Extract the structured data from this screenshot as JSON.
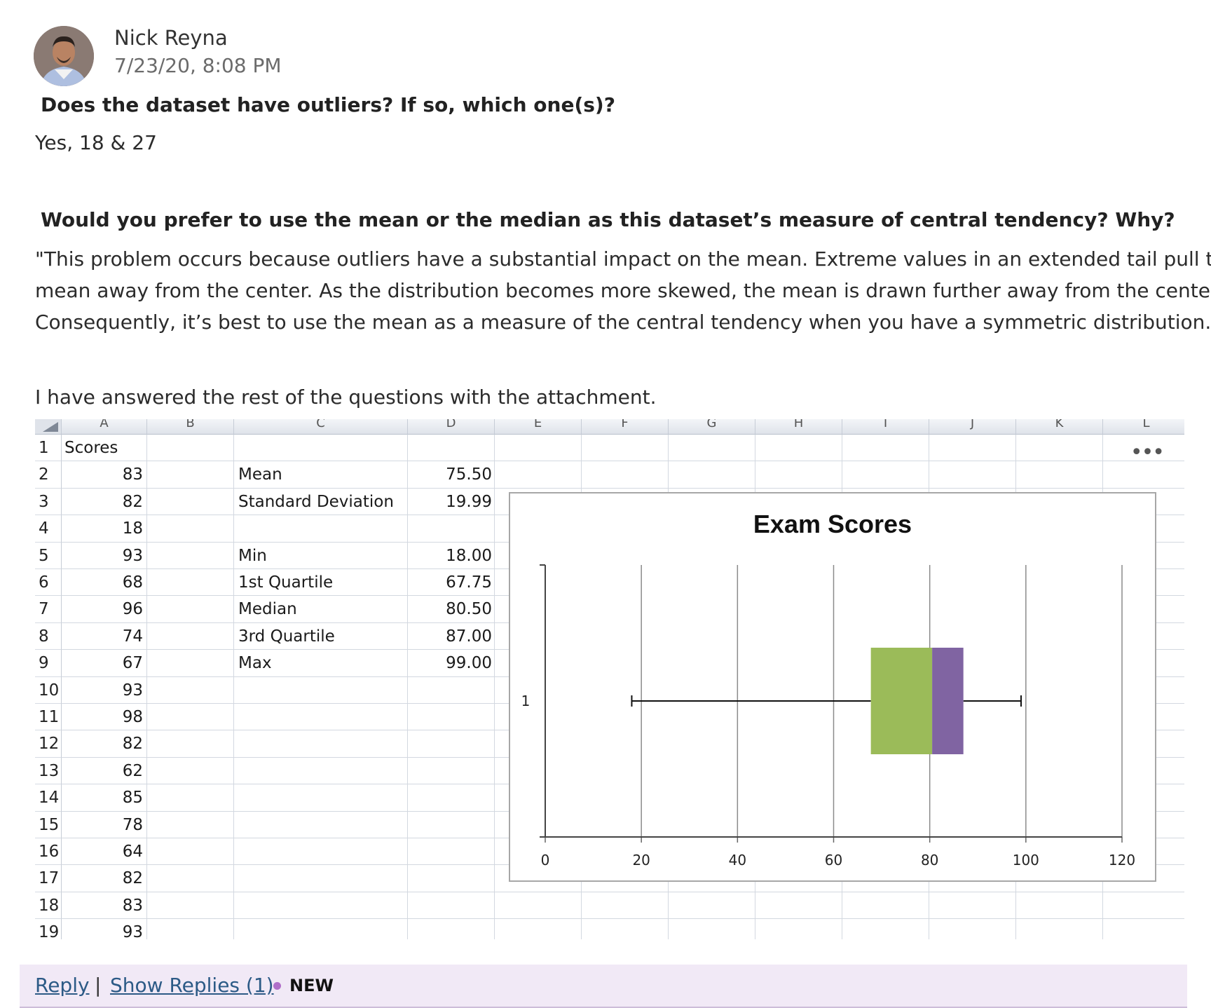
{
  "post": {
    "author": "Nick Reyna",
    "timestamp": "7/23/20, 8:08 PM",
    "q1": "Does the dataset have outliers? If so, which one(s)?",
    "a1": "Yes, 18 & 27",
    "q2": "Would you prefer to use the mean or the median as this dataset’s measure of central tendency? Why?",
    "a2_lines": [
      "\"This problem occurs because outliers have a substantial impact on the mean. Extreme values in an extended tail pull the",
      "mean away from the center. As the distribution becomes more skewed, the mean is drawn further away from the center.",
      "Consequently, it’s best to use the mean as a measure of the central tendency when you have a symmetric distribution.\""
    ],
    "note": "I have answered the rest of the questions with the attachment."
  },
  "spreadsheet": {
    "columns": [
      "A",
      "B",
      "C",
      "D",
      "E",
      "F",
      "G",
      "H",
      "I",
      "J",
      "K",
      "L"
    ],
    "rows": [
      "1",
      "2",
      "3",
      "4",
      "5",
      "6",
      "7",
      "8",
      "9",
      "10",
      "11",
      "12",
      "13",
      "14",
      "15",
      "16",
      "17",
      "18",
      "19"
    ],
    "header": "Scores",
    "scores": [
      "83",
      "82",
      "18",
      "93",
      "68",
      "96",
      "74",
      "67",
      "93",
      "98",
      "82",
      "62",
      "85",
      "78",
      "64",
      "82",
      "83",
      "93"
    ],
    "stats": [
      {
        "label": "Mean",
        "value": "75.50",
        "row": 2
      },
      {
        "label": "Standard Deviation",
        "value": "19.99",
        "row": 3
      },
      {
        "label": "Min",
        "value": "18.00",
        "row": 5
      },
      {
        "label": "1st Quartile",
        "value": "67.75",
        "row": 6
      },
      {
        "label": "Median",
        "value": "80.50",
        "row": 7
      },
      {
        "label": "3rd Quartile",
        "value": "87.00",
        "row": 8
      },
      {
        "label": "Max",
        "value": "99.00",
        "row": 9
      }
    ],
    "more_icon": "more-horizontal-icon"
  },
  "chart_data": {
    "type": "boxplot",
    "title": "Exam Scores",
    "category": "1",
    "xlim": [
      0,
      120
    ],
    "xticks": [
      "0",
      "20",
      "40",
      "60",
      "80",
      "100",
      "120"
    ],
    "grid": true,
    "min": 18,
    "q1": 67.75,
    "median": 80.5,
    "q3": 87,
    "max": 99,
    "colors": {
      "lower_box": "#9bbb59",
      "upper_box": "#8064a2"
    }
  },
  "footer": {
    "reply": "Reply",
    "separator": "|",
    "show_replies": "Show Replies (1)",
    "new_badge": "NEW"
  }
}
